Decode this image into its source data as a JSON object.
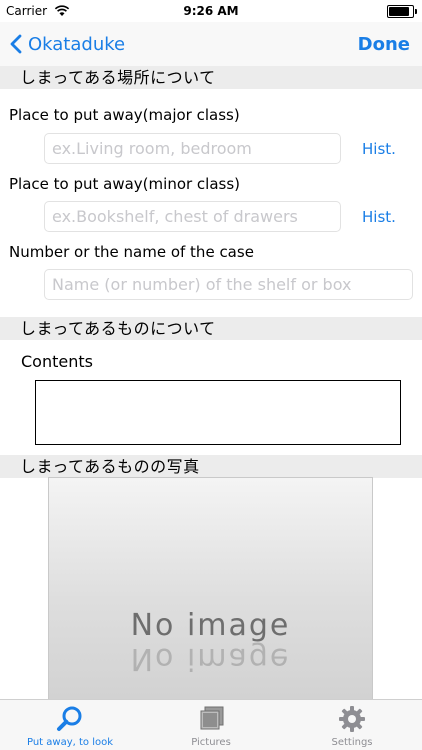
{
  "status_bar": {
    "carrier": "Carrier",
    "time": "9:26 AM",
    "battery_level": 0.95
  },
  "nav": {
    "back_label": "Okataduke",
    "done_label": "Done"
  },
  "location_section": {
    "header": "しまってある場所について",
    "major": {
      "label": "Place to put away(major class)",
      "placeholder": "ex.Living room, bedroom",
      "hist_label": "Hist."
    },
    "minor": {
      "label": "Place to put away(minor class)",
      "placeholder": "ex.Bookshelf, chest of drawers",
      "hist_label": "Hist."
    },
    "case": {
      "label": "Number or the name of the case",
      "placeholder": "Name (or number) of the shelf or box"
    }
  },
  "item_section": {
    "header": "しまってあるものについて",
    "contents_label": "Contents",
    "contents_value": ""
  },
  "photo_section": {
    "header": "しまってあるものの写真",
    "no_image_text": "No image"
  },
  "tab_bar": {
    "items": [
      {
        "label": "Put away, to look",
        "icon": "search-icon",
        "active": true
      },
      {
        "label": "Pictures",
        "icon": "pictures-icon",
        "active": false
      },
      {
        "label": "Settings",
        "icon": "gear-icon",
        "active": false
      }
    ]
  },
  "colors": {
    "accent": "#1a7ee6",
    "section_bg": "#ececec",
    "placeholder": "#c8c8cc",
    "tab_inactive": "#8e8e93"
  }
}
